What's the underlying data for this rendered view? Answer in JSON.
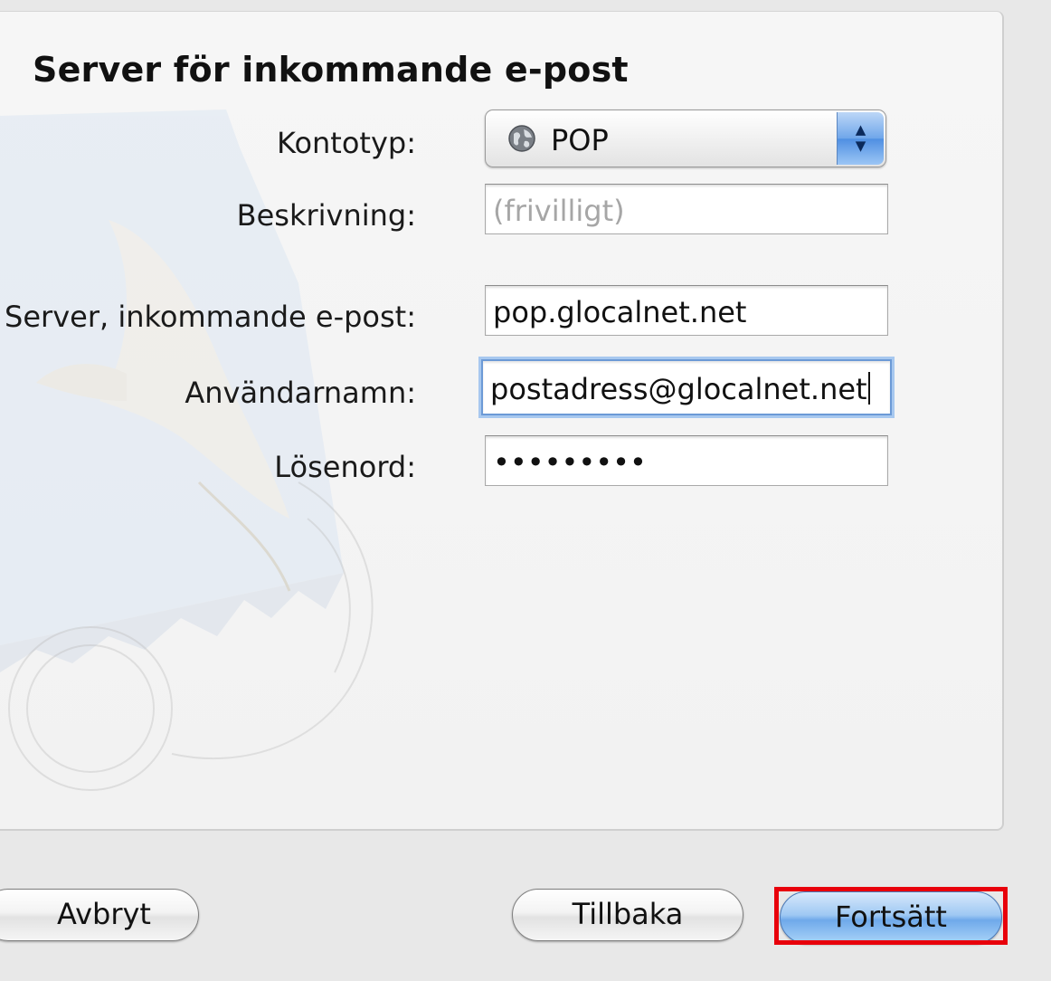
{
  "dialog": {
    "title": "Server för inkommande e-post"
  },
  "form": {
    "account_type": {
      "label": "Kontotyp:",
      "value": "POP",
      "icon": "globe-icon"
    },
    "description": {
      "label": "Beskrivning:",
      "value": "",
      "placeholder": "(frivilligt)"
    },
    "incoming_server": {
      "label": "Server, inkommande e-post:",
      "value": "pop.glocalnet.net"
    },
    "username": {
      "label": "Användarnamn:",
      "value": "postadress@glocalnet.net"
    },
    "password": {
      "label": "Lösenord:",
      "value": "•••••••••"
    }
  },
  "buttons": {
    "cancel": "Avbryt",
    "back": "Tillbaka",
    "continue": "Fortsätt"
  },
  "annotation": {
    "highlight_color": "#e8000b"
  }
}
